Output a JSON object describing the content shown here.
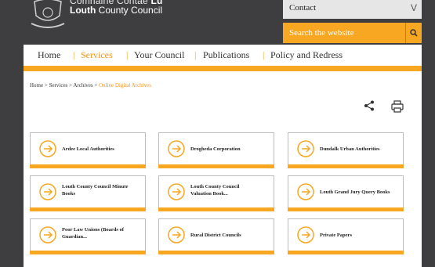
{
  "header": {
    "council_irish_prefix": "Comhairle Contae ",
    "council_irish_bold": "Lú",
    "council_en_bold": "Louth",
    "council_en_rest": " County Council"
  },
  "contact": {
    "label": "Contact",
    "chevron": "V"
  },
  "search": {
    "placeholder": "Search the website"
  },
  "nav": [
    "Home",
    "Services",
    "Your Council",
    "Publications",
    "Policy and Redress"
  ],
  "breadcrumb": {
    "items": [
      "Home",
      "Services",
      "Archives"
    ],
    "separator": " > ",
    "current": "Online Digital Archives"
  },
  "cards": [
    [
      "Ardee Local Authorities",
      ""
    ],
    [
      "Drogheda Corporation",
      ""
    ],
    [
      "Dundalk Urban Authorities",
      ""
    ],
    [
      "Louth County Council Minute",
      "Books"
    ],
    [
      "Louth County Council",
      "Valuation Book..."
    ],
    [
      "Louth Grand Jury Query Books",
      ""
    ],
    [
      "Poor Law Unions (Boards of",
      "Guardian..."
    ],
    [
      "Rural District Councils",
      ""
    ],
    [
      "Private Papers",
      ""
    ]
  ],
  "colors": {
    "accent": "#f7a721",
    "active": "#f7941d",
    "background": "#3e3e40"
  }
}
